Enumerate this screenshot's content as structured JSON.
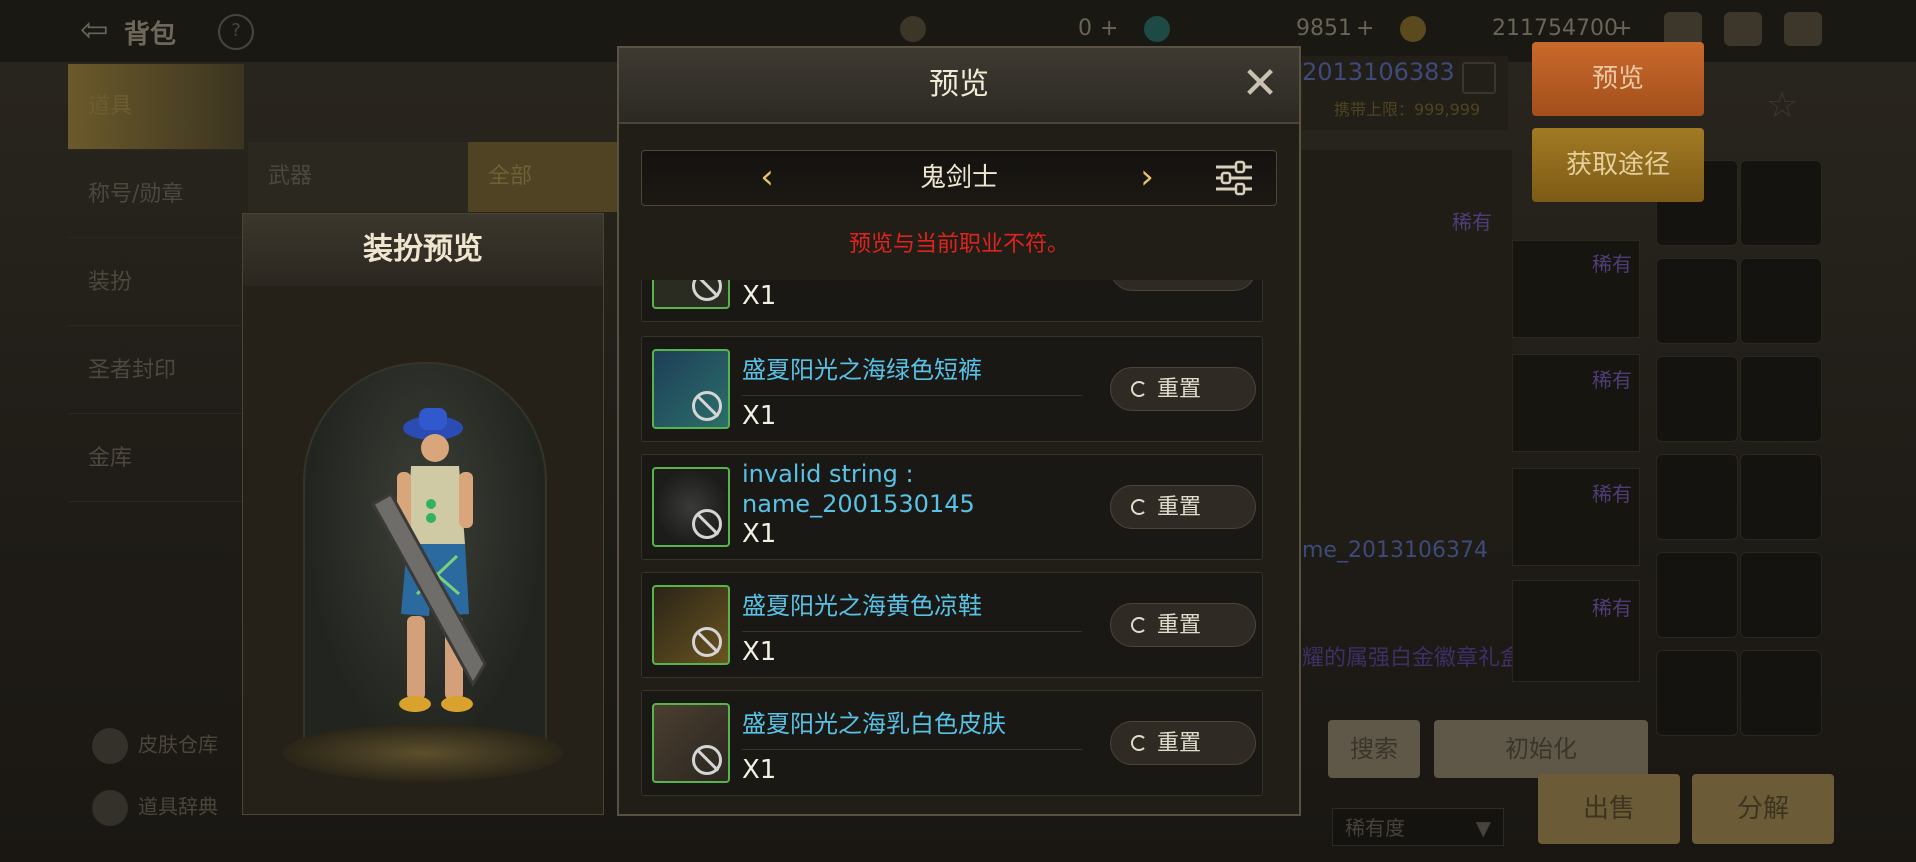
{
  "topbar": {
    "back_label": "背包",
    "currency_a": "0",
    "currency_b": "9851",
    "currency_c": "211754700"
  },
  "left_nav": {
    "items": [
      {
        "label": "道具",
        "active": true
      },
      {
        "label": "称号/勋章"
      },
      {
        "label": "装扮"
      },
      {
        "label": "圣者封印"
      },
      {
        "label": "金库"
      }
    ],
    "bottom": [
      {
        "label": "皮肤仓库"
      },
      {
        "label": "道具辞典"
      }
    ]
  },
  "tabs": [
    {
      "label": "武器"
    },
    {
      "label": "全部"
    }
  ],
  "background_right": {
    "id_text": "2013106383",
    "limit_text": "携带上限：999,999",
    "rare_labels": [
      "稀有",
      "稀有",
      "稀有",
      "稀有",
      "稀有"
    ],
    "ghost_name": "me_2013106374",
    "ghost_purple": "耀的属强白金徽章礼盒",
    "preview_btn": "预览",
    "obtain_btn": "获取途径",
    "search_btn": "搜索",
    "init_btn": "初始化",
    "rarity_select": "稀有度",
    "sell_btn": "出售",
    "decompose_btn": "分解"
  },
  "dress_preview": {
    "title": "装扮预览"
  },
  "dialog": {
    "title": "预览",
    "job": "鬼剑士",
    "warning": "预览与当前职业不符。",
    "reset_label": "重置",
    "items": [
      {
        "name": "",
        "count": "X1",
        "icon": "top-item-icon",
        "partial": true
      },
      {
        "name": "盛夏阳光之海绿色短裤",
        "count": "X1",
        "icon": "shorts-icon"
      },
      {
        "name": "invalid string : name_2001530145",
        "count": "X1",
        "icon": "belt-icon"
      },
      {
        "name": "盛夏阳光之海黄色凉鞋",
        "count": "X1",
        "icon": "sandals-icon"
      },
      {
        "name": "盛夏阳光之海乳白色皮肤",
        "count": "X1",
        "icon": "skin-icon"
      }
    ]
  },
  "colors": {
    "item_name": "#58c2e6",
    "warning": "#e0231e",
    "icon_border": "#58b34a"
  }
}
